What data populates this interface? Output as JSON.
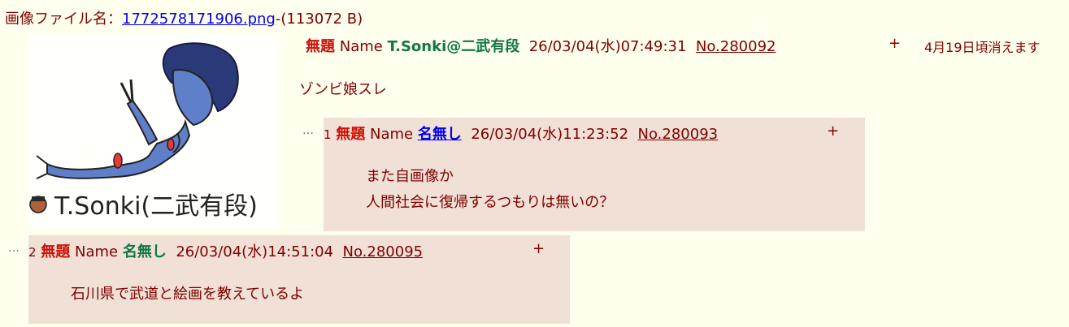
{
  "file_info": {
    "label": "画像ファイル名：",
    "filename": "1772578171906.png",
    "size": "-(113072 B)"
  },
  "op": {
    "subject": "無題",
    "name_label": "Name",
    "name": "T.Sonki@二武有段",
    "datetime": "26/03/04(水)07:49:31",
    "number": "No.280092",
    "plus": "+",
    "expiry": "4月19日頃消えます",
    "comment": "ゾンビ娘スレ",
    "image_signature": "T.Sonki(二武有段)"
  },
  "replies": [
    {
      "dots": "…",
      "index": "1",
      "subject": "無題",
      "name_label": "Name",
      "name": "名無し",
      "datetime": "26/03/04(水)11:23:52",
      "number": "No.280093",
      "plus": "+",
      "lines": [
        "また自画像か",
        "人間社会に復帰するつもりは無いの？"
      ]
    },
    {
      "dots": "…",
      "index": "2",
      "subject": "無題",
      "name_label": "Name",
      "name": "名無し",
      "datetime": "26/03/04(水)14:51:04",
      "number": "No.280095",
      "plus": "+",
      "lines": [
        "石川県で武道と絵画を教えているよ"
      ]
    }
  ],
  "colors": {
    "background": "#ffffee",
    "text": "#800000",
    "reply_bg": "#f0e0d6",
    "subject": "#cc1105",
    "name_green": "#117743",
    "link": "#0000ee"
  }
}
